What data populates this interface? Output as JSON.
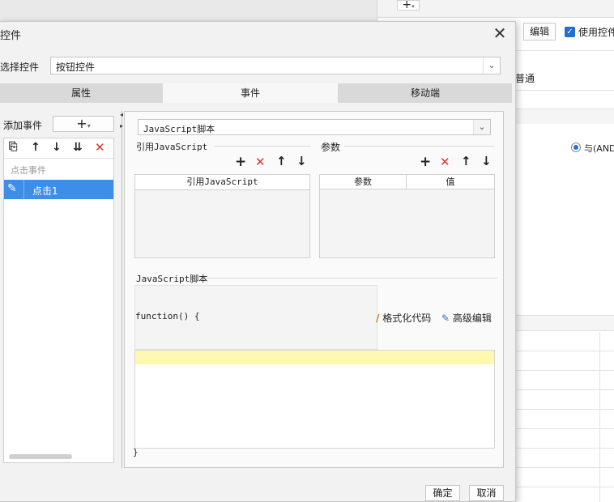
{
  "background": {
    "toolbar_add": "+",
    "edit_button": "编辑",
    "use_control_label": "使用控件",
    "use_control_checked": true,
    "normal_label": "普通",
    "and_label": "与(AND"
  },
  "dialog": {
    "title": "控件",
    "select_control_label": "选择控件",
    "select_control_value": "按钮控件",
    "tabs": [
      {
        "label": "属性",
        "active": false
      },
      {
        "label": "事件",
        "active": true
      },
      {
        "label": "移动端",
        "active": false
      }
    ],
    "left": {
      "add_event_label": "添加事件",
      "add_button": "+",
      "group_label": "点击事件",
      "events": [
        {
          "label": "点击1",
          "selected": true
        }
      ]
    },
    "main": {
      "script_type": "JavaScript脚本",
      "ref_js_label": "引用JavaScript",
      "ref_js_column": "引用JavaScript",
      "params_label": "参数",
      "params_columns": [
        "参数",
        "值"
      ],
      "script_section_label": "JavaScript脚本",
      "function_open": "function() {",
      "format_code_label": "格式化代码",
      "advanced_edit_label": "高级编辑",
      "function_close": "}"
    },
    "ok_button": "确定",
    "cancel_button": "取消"
  },
  "colors": {
    "selection_blue": "#3d8ee8",
    "editor_highlight": "#fff9b0",
    "delete_red": "#e0312e"
  }
}
